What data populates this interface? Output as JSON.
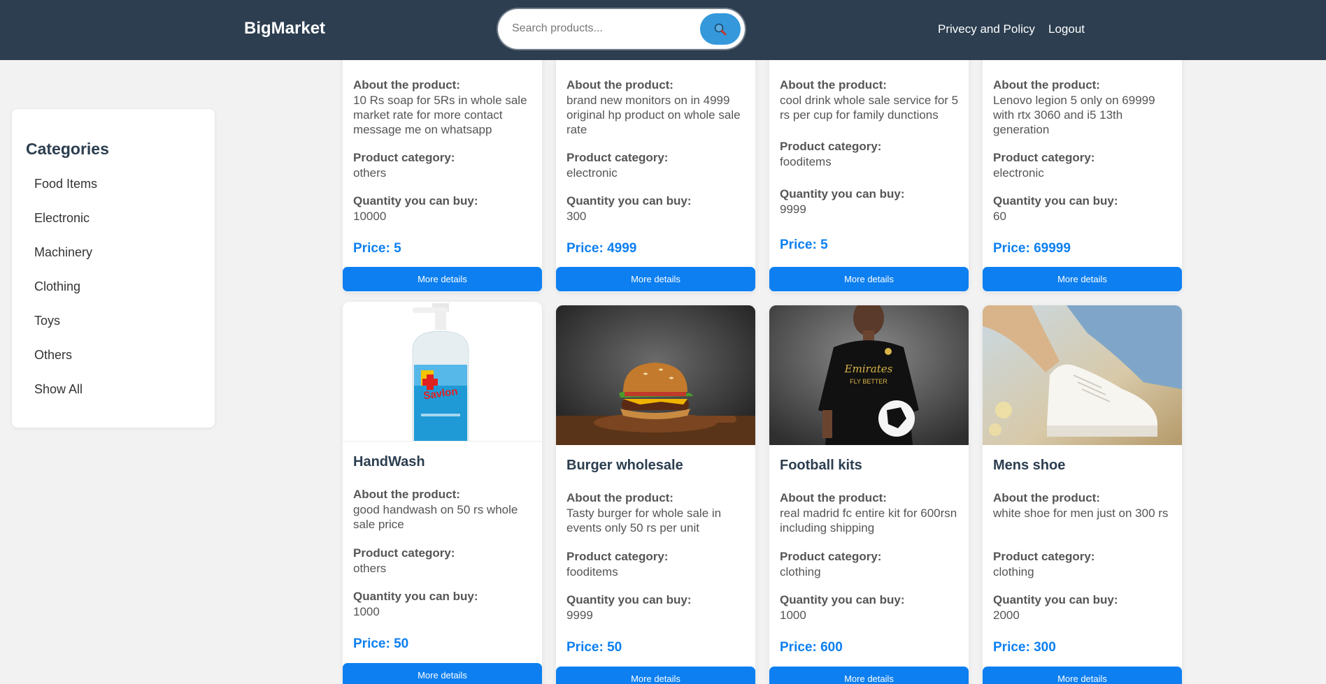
{
  "header": {
    "brand": "BigMarket",
    "search_placeholder": "Search products...",
    "privacy": "Privecy and Policy",
    "logout": "Logout"
  },
  "sidebar": {
    "title": "Categories",
    "items": [
      "Food Items",
      "Electronic",
      "Machinery",
      "Clothing",
      "Toys",
      "Others",
      "Show All"
    ]
  },
  "labels": {
    "about": "About the product:",
    "category": "Product category:",
    "quantity": "Quantity you can buy:",
    "more": "More details"
  },
  "products_top": [
    {
      "about": "10 Rs soap for 5Rs in whole sale market rate for more contact message me on whatsapp",
      "category": "others",
      "quantity": "10000",
      "price": "Price: 5"
    },
    {
      "about": "brand new monitors on in 4999 original hp product on whole sale rate",
      "category": "electronic",
      "quantity": "300",
      "price": "Price: 4999"
    },
    {
      "about": "cool drink whole sale service for 5 rs per cup for family dunctions",
      "category": "fooditems",
      "quantity": "9999",
      "price": "Price: 5"
    },
    {
      "about": "Lenovo legion 5 only on 69999 with rtx 3060 and i5 13th generation",
      "category": "electronic",
      "quantity": "60",
      "price": "Price: 69999"
    }
  ],
  "products_bottom": [
    {
      "name": "HandWash",
      "image": "handwash-bottle",
      "about": "good handwash on 50 rs whole sale price",
      "category": "others",
      "quantity": "1000",
      "price": "Price: 50"
    },
    {
      "name": "Burger wholesale",
      "image": "burger",
      "about": "Tasty burger for whole sale in events only 50 rs per unit",
      "category": "fooditems",
      "quantity": "9999",
      "price": "Price: 50"
    },
    {
      "name": "Football kits",
      "image": "football-kit",
      "about": "real madrid fc entire kit for 600rsn including shipping",
      "category": "clothing",
      "quantity": "1000",
      "price": "Price: 600"
    },
    {
      "name": "Mens shoe",
      "image": "white-shoe",
      "about": "white shoe for men just on 300 rs",
      "category": "clothing",
      "quantity": "2000",
      "price": "Price: 300"
    }
  ],
  "colors": {
    "navbar": "#2c3e50",
    "accent": "#0d7ff0",
    "search_button": "#3498db"
  }
}
